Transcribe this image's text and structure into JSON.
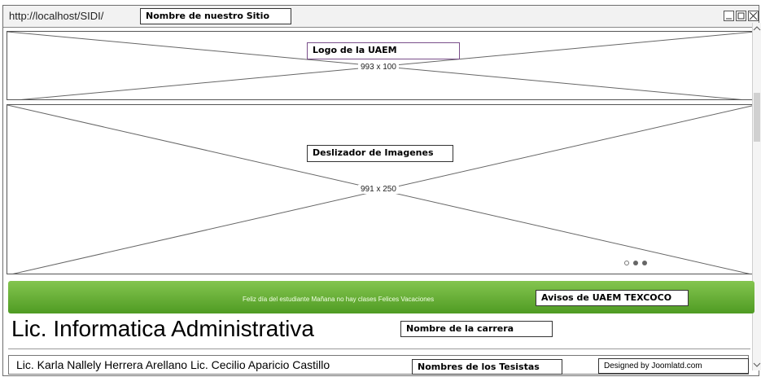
{
  "window": {
    "url": "http://localhost/SIDI/",
    "site_name_callout": "Nombre de nuestro Sitio"
  },
  "logo": {
    "callout": "Logo de la UAEM",
    "size_label": "993 x 100"
  },
  "slider": {
    "callout": "Deslizador de Imagenes",
    "size_label": "991 x 250",
    "pager": [
      {
        "state": "inactive"
      },
      {
        "state": "active"
      },
      {
        "state": "active"
      }
    ]
  },
  "notice_bar": {
    "text": "Feliz día del estudiante Mañana no hay clases Felices Vacaciones",
    "callout": "Avisos de UAEM TEXCOCO",
    "colors": {
      "top": "#84c54f",
      "bottom": "#4f9b23"
    }
  },
  "career": {
    "title": "Lic. Informatica Administrativa",
    "callout": "Nombre de la carrera"
  },
  "footer": {
    "authors": "Lic. Karla Nallely Herrera Arellano Lic. Cecilio Aparicio Castillo",
    "callout": "Nombres de los Tesistas",
    "credit": "Designed by Joomlatd.com"
  }
}
